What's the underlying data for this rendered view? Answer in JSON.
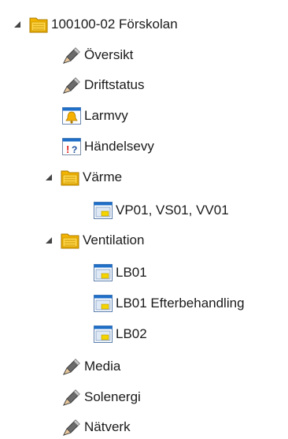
{
  "tree": {
    "items": [
      {
        "label": "100100-02 Förskolan",
        "icon": "folder-icon",
        "expanded": true
      },
      {
        "label": "Översikt",
        "icon": "pencil-icon"
      },
      {
        "label": "Driftstatus",
        "icon": "pencil-icon"
      },
      {
        "label": "Larmvy",
        "icon": "alarm-bell-icon"
      },
      {
        "label": "Händelsevy",
        "icon": "event-view-icon"
      },
      {
        "label": "Värme",
        "icon": "folder-icon",
        "expanded": true
      },
      {
        "label": "VP01, VS01, VV01",
        "icon": "window-icon"
      },
      {
        "label": "Ventilation",
        "icon": "folder-icon",
        "expanded": true
      },
      {
        "label": "LB01",
        "icon": "window-icon"
      },
      {
        "label": "LB01 Efterbehandling",
        "icon": "window-icon"
      },
      {
        "label": "LB02",
        "icon": "window-icon"
      },
      {
        "label": "Media",
        "icon": "pencil-icon"
      },
      {
        "label": "Solenergi",
        "icon": "pencil-icon"
      },
      {
        "label": "Nätverk",
        "icon": "pencil-icon"
      }
    ]
  }
}
